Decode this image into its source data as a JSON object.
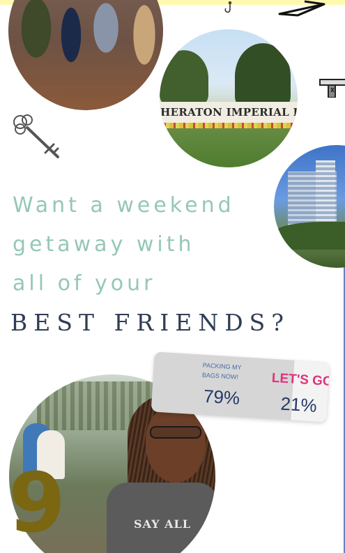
{
  "headline": {
    "line1": "Want a weekend",
    "line2": "getaway with",
    "line3": "all of your",
    "emphasis": "BEST FRIENDS?"
  },
  "photos": {
    "hotel_sign_text": "SHERATON IMPERIAL HOT",
    "shirt_text": "SAY ALL"
  },
  "poll": {
    "option_a": {
      "label": "PACKING MY BAGS NOW!",
      "percent": "79%",
      "value": 79
    },
    "option_b": {
      "label": "LET'S GO!",
      "percent": "21%",
      "value": 21
    }
  },
  "page_number": "9",
  "colors": {
    "headline_light": "#95c7b8",
    "headline_dark": "#2f3d55",
    "poll_pink": "#e0337c",
    "poll_navy": "#24386a",
    "number_gold": "#7b6612",
    "top_band": "#fff9b0"
  },
  "icons": [
    "hook-icon",
    "paper-plane-icon",
    "key-icon",
    "signpost-icon"
  ]
}
